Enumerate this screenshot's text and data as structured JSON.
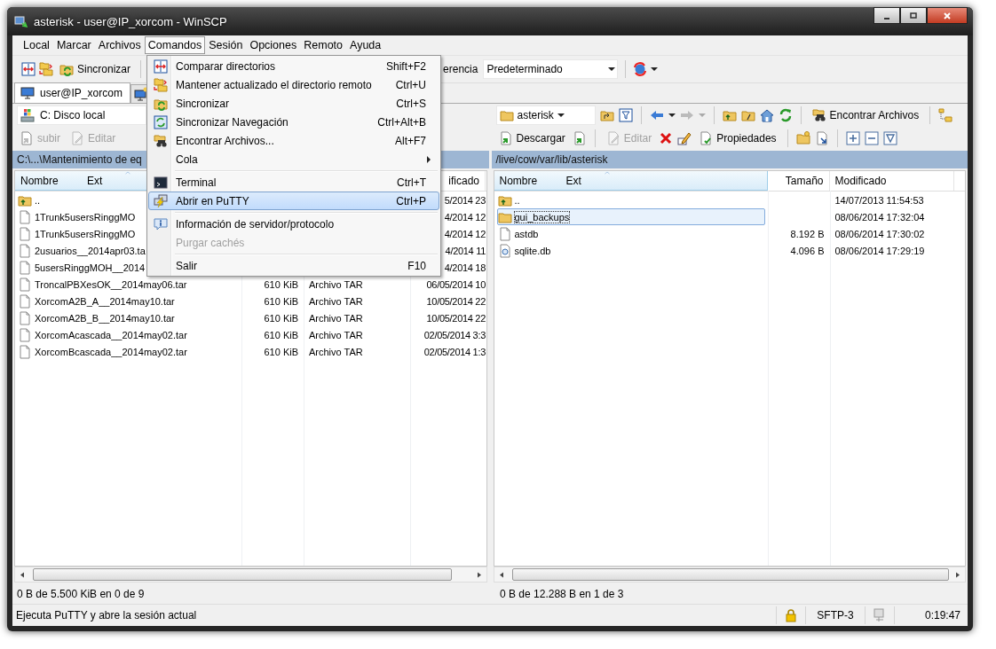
{
  "window": {
    "title": "asterisk - user@IP_xorcom - WinSCP"
  },
  "menubar": [
    {
      "label": "Local",
      "selected": false
    },
    {
      "label": "Marcar",
      "selected": false
    },
    {
      "label": "Archivos",
      "selected": false
    },
    {
      "label": "Comandos",
      "selected": true
    },
    {
      "label": "Sesión",
      "selected": false
    },
    {
      "label": "Opciones",
      "selected": false
    },
    {
      "label": "Remoto",
      "selected": false
    },
    {
      "label": "Ayuda",
      "selected": false
    }
  ],
  "toolbar": {
    "synchronize": "Sincronizar",
    "transfer_label": "erencia",
    "transfer_setting": "Predeterminado"
  },
  "tabs": [
    {
      "label": "user@IP_xorcom",
      "selected": true
    }
  ],
  "local": {
    "drive": "C: Disco local",
    "buttons": [
      {
        "label": "subir",
        "disabled": true
      },
      {
        "label": "Editar",
        "disabled": true
      }
    ],
    "path": "C:\\...\\Mantenimiento de eq",
    "columns": {
      "name": "Nombre",
      "ext": "Ext",
      "modified": "ificado"
    },
    "rows": [
      {
        "kind": "parent",
        "name": "..",
        "modified": "5/2014 23"
      },
      {
        "kind": "file",
        "name": "1Trunk5usersRinggMO",
        "modified": "4/2014 12"
      },
      {
        "kind": "file",
        "name": "1Trunk5usersRinggMO",
        "modified": "4/2014 12"
      },
      {
        "kind": "file",
        "name": "2usuarios__2014apr03.ta",
        "modified": "4/2014 11"
      },
      {
        "kind": "file",
        "name": "5usersRinggMOH__2014",
        "modified": "4/2014 18"
      },
      {
        "kind": "file",
        "name": "TroncalPBXesOK__2014may06.tar",
        "size": "610 KiB",
        "type": "Archivo TAR",
        "modified": "06/05/2014 10"
      },
      {
        "kind": "file",
        "name": "XorcomA2B_A__2014may10.tar",
        "size": "610 KiB",
        "type": "Archivo TAR",
        "modified": "10/05/2014 22"
      },
      {
        "kind": "file",
        "name": "XorcomA2B_B__2014may10.tar",
        "size": "610 KiB",
        "type": "Archivo TAR",
        "modified": "10/05/2014 22"
      },
      {
        "kind": "file",
        "name": "XorcomAcascada__2014may02.tar",
        "size": "610 KiB",
        "type": "Archivo TAR",
        "modified": "02/05/2014 3:3"
      },
      {
        "kind": "file",
        "name": "XorcomBcascada__2014may02.tar",
        "size": "610 KiB",
        "type": "Archivo TAR",
        "modified": "02/05/2014 1:3"
      }
    ],
    "summary": "0 B de 5.500 KiB en 0 de 9"
  },
  "remote": {
    "directory": "asterisk",
    "find": "Encontrar Archivos",
    "buttons": [
      {
        "label": "Descargar",
        "disabled": false
      },
      {
        "label": "Editar",
        "disabled": true
      },
      {
        "label": "Propiedades",
        "disabled": false
      }
    ],
    "path": "/live/cow/var/lib/asterisk",
    "columns": {
      "name": "Nombre",
      "ext": "Ext",
      "size": "Tamaño",
      "modified": "Modificado"
    },
    "rows": [
      {
        "kind": "parent",
        "name": "..",
        "modified": "14/07/2013 11:54:53",
        "selected": false
      },
      {
        "kind": "folder",
        "name": "gui_backups",
        "modified": "08/06/2014 17:32:04",
        "selected": true
      },
      {
        "kind": "file",
        "name": "astdb",
        "size": "8.192 B",
        "modified": "08/06/2014 17:30:02",
        "selected": false
      },
      {
        "kind": "db",
        "name": "sqlite.db",
        "size": "4.096 B",
        "modified": "08/06/2014 17:29:19",
        "selected": false
      }
    ],
    "summary": "0 B de 12.288 B en 1 de 3"
  },
  "menu": [
    {
      "kind": "item",
      "label": "Comparar directorios",
      "shortcut": "Shift+F2",
      "disabled": false,
      "selected": false
    },
    {
      "kind": "item",
      "label": "Mantener actualizado el directorio remoto",
      "shortcut": "Ctrl+U",
      "disabled": false,
      "selected": false
    },
    {
      "kind": "item",
      "label": "Sincronizar",
      "shortcut": "Ctrl+S",
      "disabled": false,
      "selected": false
    },
    {
      "kind": "item",
      "label": "Sincronizar Navegación",
      "shortcut": "Ctrl+Alt+B",
      "disabled": false,
      "selected": false
    },
    {
      "kind": "item",
      "label": "Encontrar Archivos...",
      "shortcut": "Alt+F7",
      "disabled": false,
      "selected": false
    },
    {
      "kind": "submenu",
      "label": "Cola",
      "disabled": false,
      "selected": false
    },
    {
      "kind": "separator"
    },
    {
      "kind": "item",
      "label": "Terminal",
      "shortcut": "Ctrl+T",
      "disabled": false,
      "selected": false
    },
    {
      "kind": "item",
      "label": "Abrir en PuTTY",
      "shortcut": "Ctrl+P",
      "disabled": false,
      "selected": true
    },
    {
      "kind": "separator"
    },
    {
      "kind": "item",
      "label": "Información de servidor/protocolo",
      "disabled": false,
      "selected": false
    },
    {
      "kind": "item",
      "label": "Purgar cachés",
      "disabled": true,
      "selected": false
    },
    {
      "kind": "separator"
    },
    {
      "kind": "item",
      "label": "Salir",
      "shortcut": "F10",
      "disabled": false,
      "selected": false
    }
  ],
  "status_bar": {
    "message": "Ejecuta PuTTY y abre la sesión actual",
    "protocol": "SFTP-3",
    "time": "0:19:47"
  }
}
